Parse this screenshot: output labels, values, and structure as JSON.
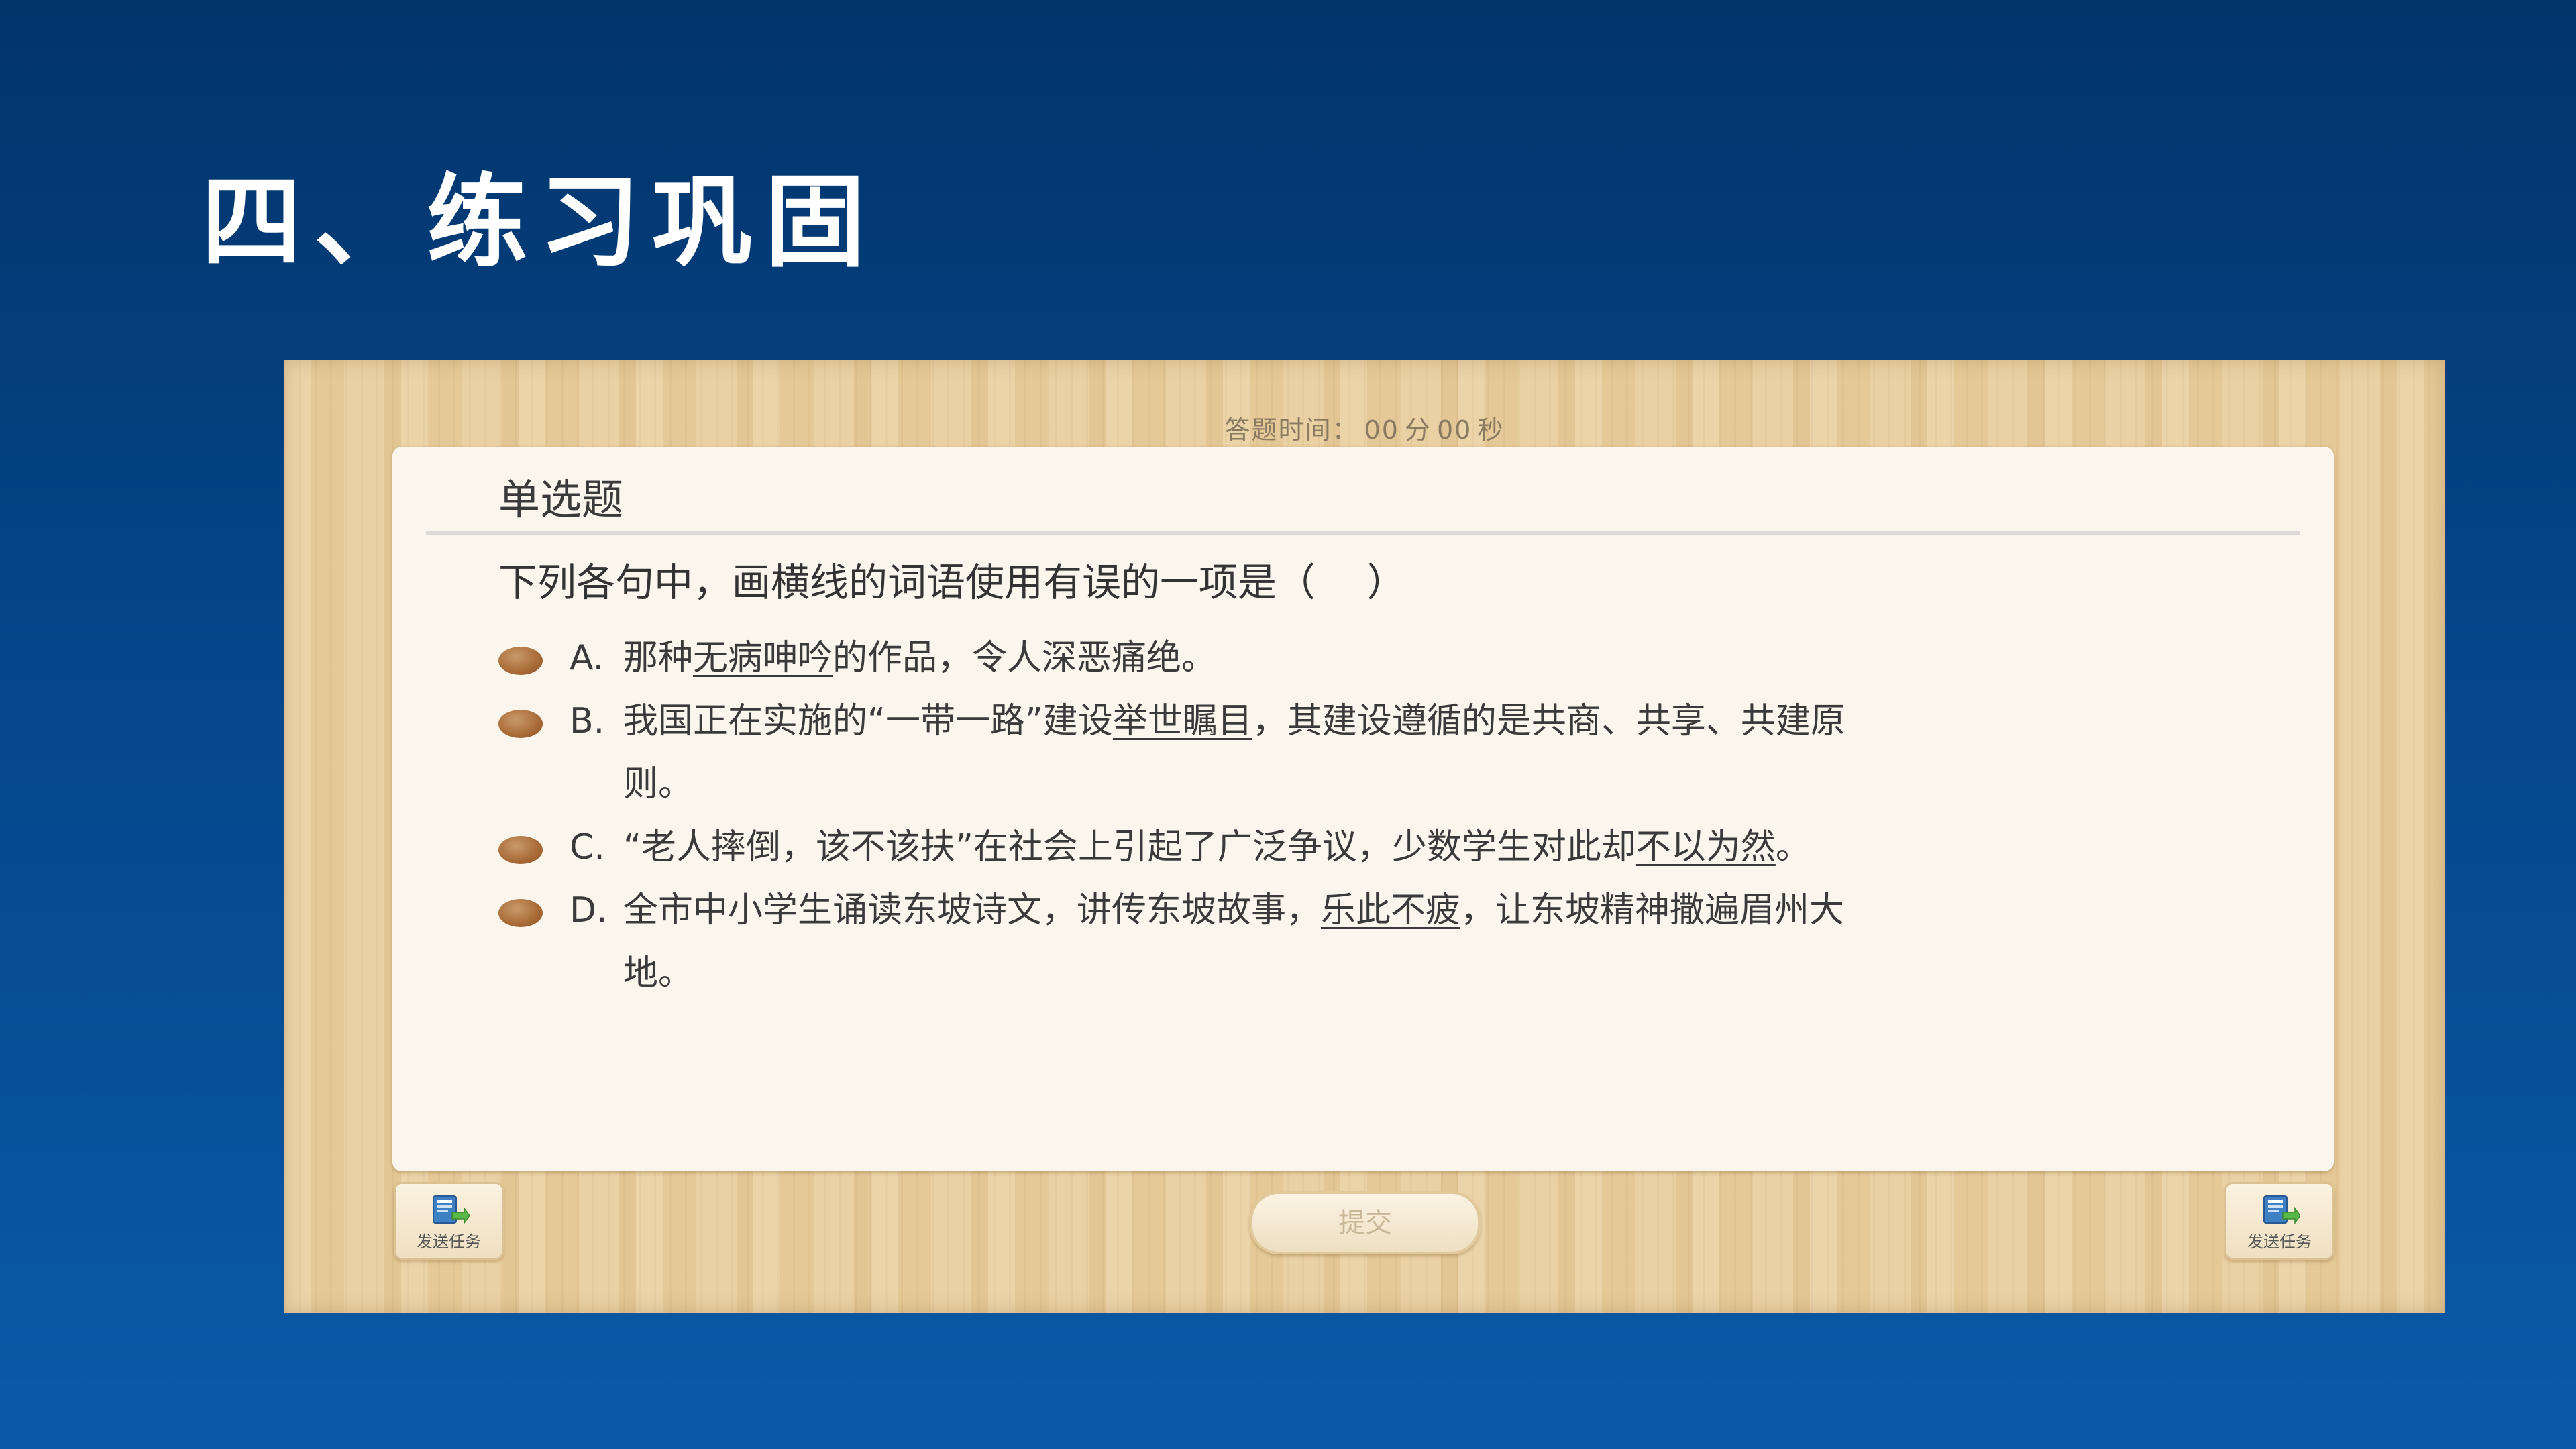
{
  "slide": {
    "title": "四、练习巩固"
  },
  "quiz": {
    "timer": {
      "label": "答题时间：",
      "minutes": "00",
      "minutes_unit": "分",
      "seconds": "00",
      "seconds_unit": "秒"
    },
    "question_type": "单选题",
    "question": "下列各句中，画横线的词语使用有误的一项是（　 ）",
    "options": [
      {
        "letter": "A.",
        "before": "那种",
        "underlined": "无病呻吟",
        "after": "的作品，令人深恶痛绝。"
      },
      {
        "letter": "B.",
        "before": "我国正在实施的“一带一路”建设",
        "underlined": "举世瞩目",
        "after": "，其建设遵循的是共商、共享、共建原",
        "continuation": "则。"
      },
      {
        "letter": "C.",
        "before": "“老人摔倒，该不该扶”在社会上引起了广泛争议，少数学生对此却",
        "underlined": "不以为然",
        "after": "。"
      },
      {
        "letter": "D.",
        "before": "全市中小学生诵读东坡诗文，讲传东坡故事，",
        "underlined": "乐此不疲",
        "after": "，让东坡精神撒遍眉州大",
        "continuation": "地。"
      }
    ],
    "submit_label": "提交",
    "send_task_label": "发送任务"
  },
  "colors": {
    "background_top": "#02346a",
    "background_bottom": "#0a5aa8",
    "wood": "#e9cf9e",
    "card": "#faf6ee",
    "radio": "#a86a36"
  }
}
